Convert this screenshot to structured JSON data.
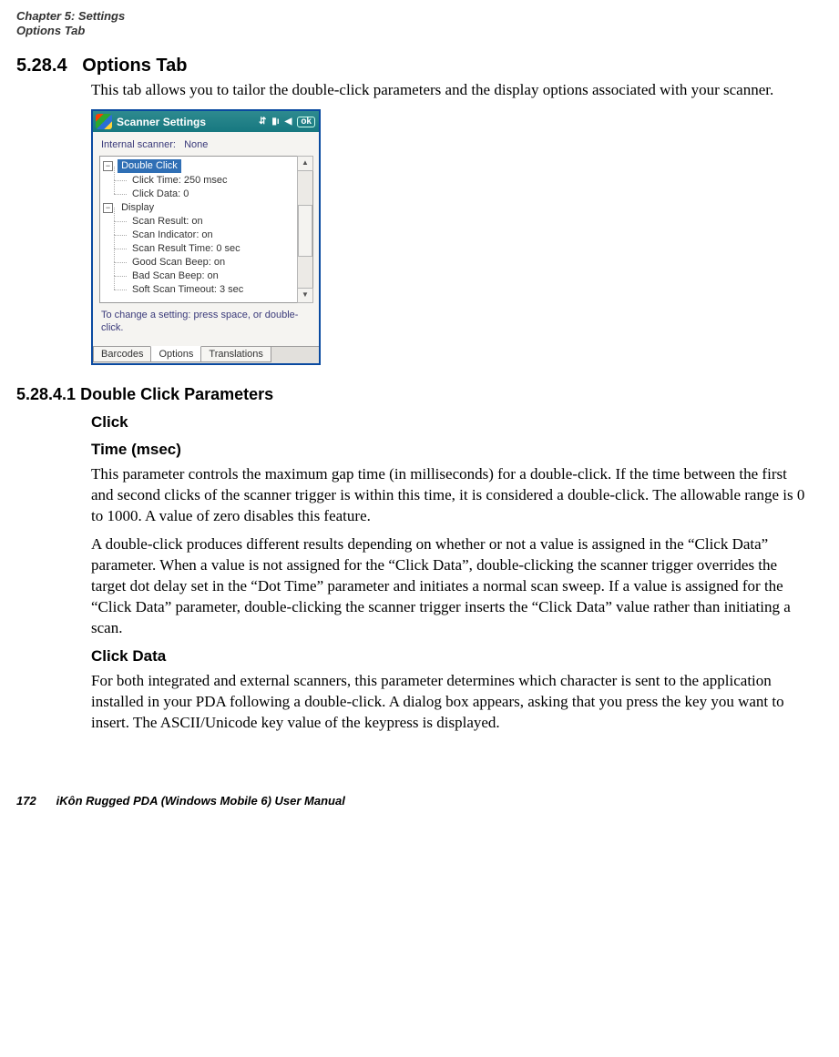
{
  "header": {
    "line1": "Chapter 5: Settings",
    "line2": "Options Tab"
  },
  "section": {
    "number": "5.28.4",
    "title": "Options Tab",
    "intro": "This tab allows you to tailor the double-click parameters and the display options associated with your scanner."
  },
  "screenshot": {
    "title": "Scanner Settings",
    "ok": "ok",
    "internal_label": "Internal scanner:",
    "internal_value": "None",
    "tree": {
      "group1": {
        "toggle": "−",
        "label": "Double Click",
        "items": [
          "Click Time: 250 msec",
          "Click Data: 0"
        ]
      },
      "group2": {
        "toggle": "−",
        "label": "Display",
        "items": [
          "Scan Result: on",
          "Scan Indicator: on",
          "Scan Result Time: 0 sec",
          "Good Scan Beep: on",
          "Bad Scan Beep: on",
          "Soft Scan Timeout: 3 sec"
        ]
      }
    },
    "hint": "To change a setting: press space, or double-click.",
    "tabs": [
      "Barcodes",
      "Options",
      "Translations"
    ],
    "active_tab_index": 1
  },
  "subsection": {
    "number": "5.28.4.1",
    "title": "Double Click Parameters"
  },
  "param_click": {
    "label1": "Click",
    "label2": "Time (msec)",
    "para1": "This parameter controls the maximum gap time (in milliseconds) for a double-click. If the time between the first and second clicks of the scanner trigger is within this time, it is considered a double-click. The allowable range is 0 to 1000. A value of zero disables this feature.",
    "para2": "A double-click produces different results depending on whether or not a value is assigned in the “Click Data” parameter. When a value is not assigned for the “Click Data”, double-clicking the scanner trigger overrides the target dot delay set in the “Dot Time” parameter and initiates a normal scan sweep. If a value is assigned for the “Click Data” parameter, double-clicking the scanner trigger inserts the “Click Data” value rather than initiating a scan."
  },
  "param_clickdata": {
    "label": "Click Data",
    "para": "For both integrated and external scanners, this parameter determines which character is sent to the application installed in your PDA following a double-click. A dialog box appears, asking that you press the key you want to insert. The ASCII/Unicode key value of the keypress is displayed."
  },
  "footer": {
    "page": "172",
    "manual": "iKôn Rugged PDA (Windows Mobile 6) User Manual"
  }
}
